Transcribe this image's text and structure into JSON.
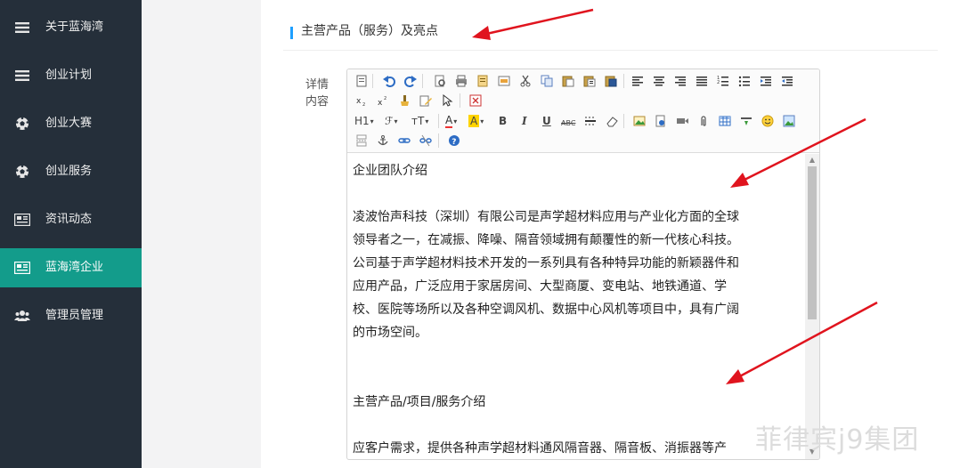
{
  "sidebar": {
    "items": [
      {
        "label": "关于蓝海湾",
        "icon": "menu-lines-icon",
        "active": false
      },
      {
        "label": "创业计划",
        "icon": "menu-lines-icon",
        "active": false
      },
      {
        "label": "创业大赛",
        "icon": "soccer-ball-icon",
        "active": false
      },
      {
        "label": "创业服务",
        "icon": "soccer-ball-icon",
        "active": false
      },
      {
        "label": "资讯动态",
        "icon": "newspaper-icon",
        "active": false
      },
      {
        "label": "蓝海湾企业",
        "icon": "newspaper-icon",
        "active": true
      },
      {
        "label": "管理员管理",
        "icon": "users-icon",
        "active": false
      }
    ],
    "active_color": "#139c8b"
  },
  "section": {
    "title": "主营产品（服务）及亮点"
  },
  "field": {
    "label": "详情内容"
  },
  "editor": {
    "toolbar_labels": {
      "heading": "H1",
      "font_family": "ℱ",
      "font_size": "тT",
      "font_color": "A",
      "bg_color": "A",
      "bold": "B",
      "italic": "I",
      "underline": "U",
      "strikethrough": "ABC"
    },
    "content": [
      "企业团队介绍",
      "",
      "凌波怡声科技（深圳）有限公司是声学超材料应用与产业化方面的全球",
      "领导者之一，在减振、降噪、隔音领域拥有颠覆性的新一代核心科技。",
      "公司基于声学超材料技术开发的一系列具有各种特异功能的新颖器件和",
      "应用产品，广泛应用于家居房间、大型商厦、变电站、地铁通道、学",
      "校、医院等场所以及各种空调风机、数据中心风机等项目中，具有广阔",
      "的市场空间。",
      "",
      "",
      "主营产品/项目/服务介绍",
      "",
      "应客户需求，提供各种声学超材料通风隔音器、隔音板、消振器等产"
    ]
  },
  "watermark": "菲律宾j9集团",
  "colors": {
    "sidebar_bg": "#252f3a",
    "accent_blue": "#1e9fff",
    "arrow_red": "#e0141e"
  }
}
